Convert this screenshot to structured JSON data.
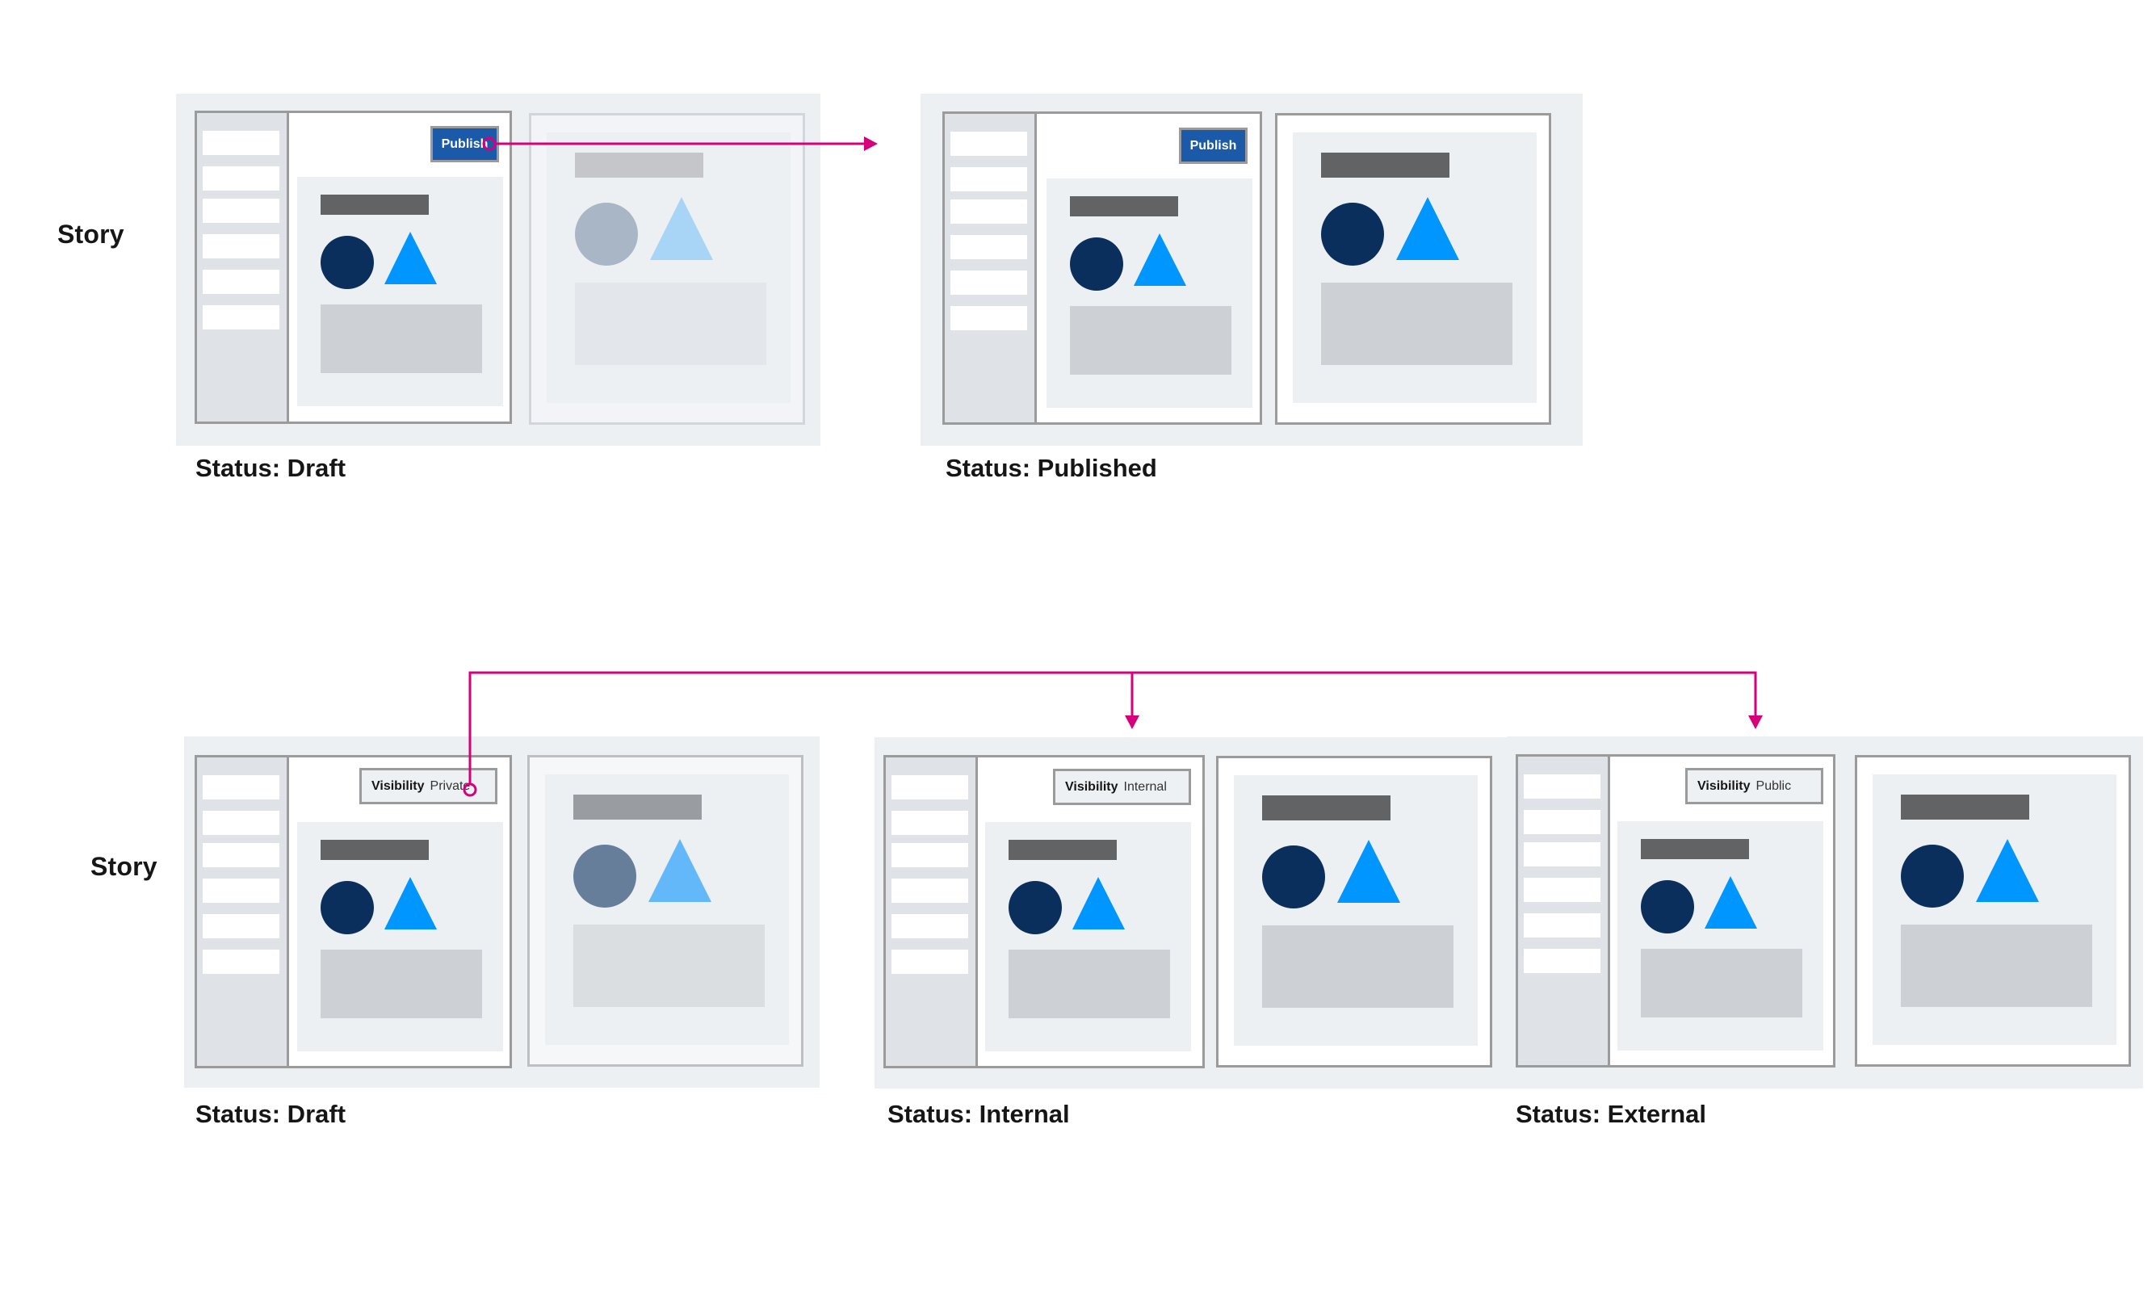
{
  "accent_color": "#d6007a",
  "rows": [
    {
      "label": "Story",
      "scenes": [
        {
          "status": "Status: Draft",
          "control": {
            "type": "button",
            "label": "Publish"
          },
          "sidebar_item_count": 6,
          "preview_state": "faint"
        },
        {
          "status": "Status: Published",
          "control": {
            "type": "button",
            "label": "Publish"
          },
          "sidebar_item_count": 6,
          "preview_state": "full"
        }
      ]
    },
    {
      "label": "Story",
      "scenes": [
        {
          "status": "Status: Draft",
          "control": {
            "type": "visibility",
            "key": "Visibility",
            "value": "Private"
          },
          "sidebar_item_count": 6,
          "preview_state": "mid"
        },
        {
          "status": "Status: Internal",
          "control": {
            "type": "visibility",
            "key": "Visibility",
            "value": "Internal"
          },
          "sidebar_item_count": 6,
          "preview_state": "full"
        },
        {
          "status": "Status: External",
          "control": {
            "type": "visibility",
            "key": "Visibility",
            "value": "Public"
          },
          "sidebar_item_count": 6,
          "preview_state": "full"
        }
      ]
    }
  ],
  "colors": {
    "button_blue": "#1a5aa8",
    "circle_navy": "#0a2f5c",
    "triangle_blue": "#0096ff",
    "panel_bg": "#edf0f3"
  }
}
